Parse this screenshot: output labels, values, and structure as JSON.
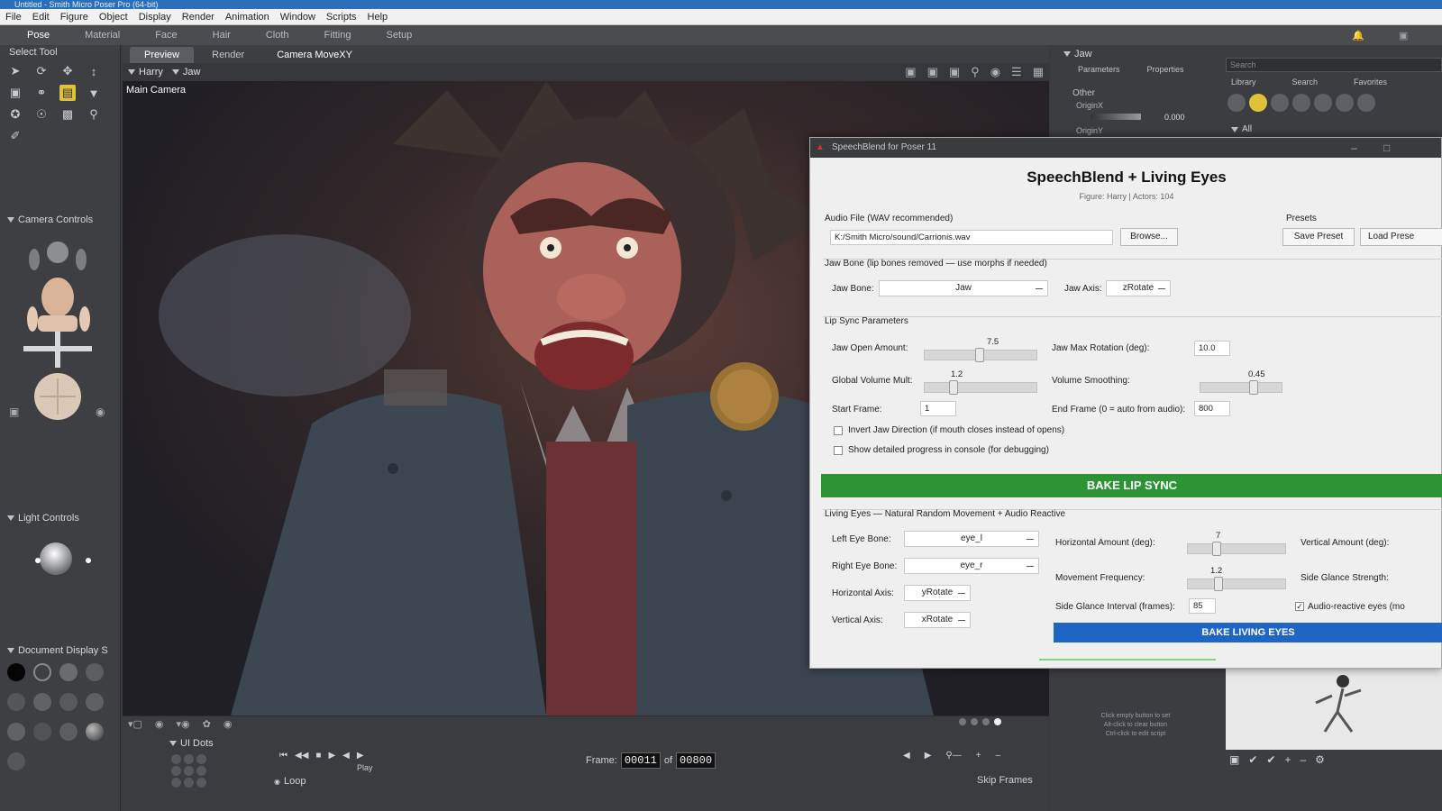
{
  "window": {
    "title": "Untitled - Smith Micro Poser Pro (64-bit)"
  },
  "menu": [
    "File",
    "Edit",
    "Figure",
    "Object",
    "Display",
    "Render",
    "Animation",
    "Window",
    "Scripts",
    "Help"
  ],
  "rooms": [
    "Pose",
    "Material",
    "Face",
    "Hair",
    "Cloth",
    "Fitting",
    "Setup"
  ],
  "active_room": "Pose",
  "left": {
    "select_tool": "Select Tool",
    "camera_controls": "Camera Controls",
    "light_controls": "Light Controls",
    "document_display": "Document Display S",
    "ui_dots": "UI Dots"
  },
  "viewport": {
    "tabs": [
      "Preview",
      "Render",
      "Camera MoveXY"
    ],
    "figure": "Harry",
    "actor": "Jaw",
    "camera": "Main Camera"
  },
  "timeline": {
    "frame_label": "Frame:",
    "frame": "00011",
    "of_label": "of",
    "total": "00800",
    "loop": "Loop",
    "play": "Play",
    "skip_frames": "Skip Frames"
  },
  "right": {
    "actor": "Jaw",
    "tabs": [
      "Parameters",
      "Properties"
    ],
    "group": "Other",
    "param1": "OriginX",
    "param1_value": "0.000",
    "param2": "OriginY",
    "library_tabs": [
      "Library",
      "Search",
      "Favorites"
    ],
    "search_placeholder": "Search",
    "all": "All",
    "hint_lines": [
      "Click empty button to set",
      "Alt-click to clear button",
      "Ctrl-click to edit script"
    ]
  },
  "dialog": {
    "title": "SpeechBlend for Poser 11",
    "heading": "SpeechBlend + Living Eyes",
    "subtitle": "Figure: Harry  |  Actors: 104",
    "audio_label": "Audio File (WAV recommended)",
    "audio_path": "K:/Smith Micro/sound/Carrionis.wav",
    "browse": "Browse...",
    "presets_label": "Presets",
    "save_preset": "Save Preset",
    "load_preset": "Load Prese",
    "jaw_group": "Jaw Bone (lip bones removed — use morphs if needed)",
    "jaw_bone_label": "Jaw Bone:",
    "jaw_bone": "Jaw",
    "jaw_axis_label": "Jaw Axis:",
    "jaw_axis": "zRotate",
    "lip_group": "Lip Sync Parameters",
    "jaw_open_label": "Jaw Open Amount:",
    "jaw_open": 7.5,
    "jaw_max_label": "Jaw Max Rotation (deg):",
    "jaw_max": "10.0",
    "global_vol_label": "Global Volume Mult:",
    "global_vol": 1.2,
    "vol_smooth_label": "Volume Smoothing:",
    "vol_smooth": 0.45,
    "start_frame_label": "Start Frame:",
    "start_frame": "1",
    "end_frame_label": "End Frame (0 = auto from audio):",
    "end_frame": "800",
    "invert_label": "Invert Jaw Direction (if mouth closes instead of opens)",
    "progress_label": "Show detailed progress in console (for debugging)",
    "bake_lip": "BAKE LIP SYNC",
    "eyes_group": "Living Eyes — Natural Random Movement + Audio Reactive",
    "left_eye_label": "Left Eye Bone:",
    "left_eye": "eye_l",
    "right_eye_label": "Right Eye Bone:",
    "right_eye": "eye_r",
    "h_axis_label": "Horizontal Axis:",
    "h_axis": "yRotate",
    "v_axis_label": "Vertical Axis:",
    "v_axis": "xRotate",
    "h_amount_label": "Horizontal Amount (deg):",
    "h_amount": 7.0,
    "v_amount_label": "Vertical Amount (deg):",
    "move_freq_label": "Movement Frequency:",
    "move_freq": 1.2,
    "side_glance_label": "Side Glance Strength:",
    "side_interval_label": "Side Glance Interval (frames):",
    "side_interval": "85",
    "audio_reactive_label": "Audio-reactive eyes (mo",
    "bake_eyes": "BAKE LIVING EYES"
  },
  "colors": {
    "bake_green": "#2d9436",
    "bake_blue": "#1f66c4",
    "accent_yellow": "#e0c23a"
  }
}
